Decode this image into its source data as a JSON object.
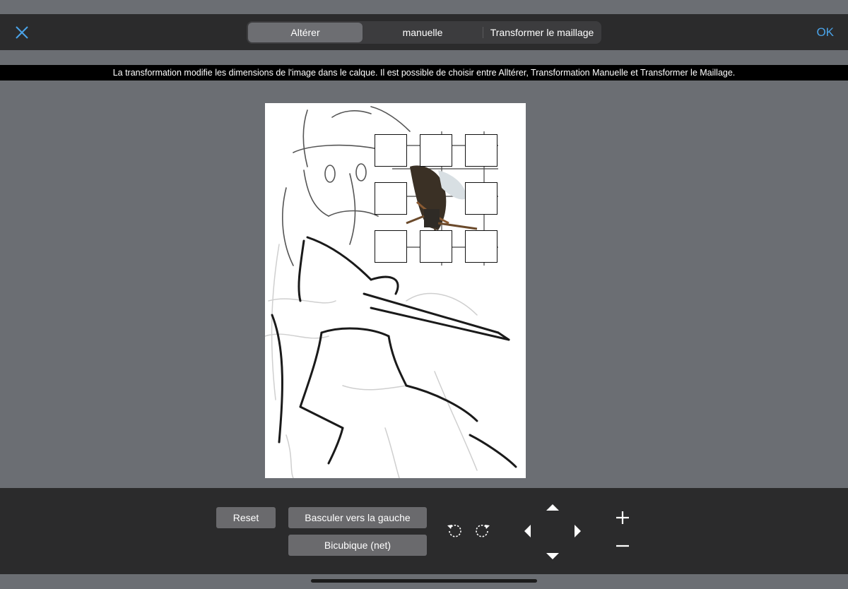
{
  "topbar": {
    "tabs": [
      {
        "label": "Altérer"
      },
      {
        "label": "manuelle"
      },
      {
        "label": "Transformer le maillage"
      }
    ],
    "ok_label": "OK"
  },
  "info_text": "La transformation modifie les dimensions de l'image dans le calque. Il est possible de choisir entre Alltérer, Transformation Manuelle et Transformer le Maillage.",
  "toolbar": {
    "reset_label": "Reset",
    "flip_label": "Basculer vers la gauche",
    "interp_label": "Bicubique (net)"
  },
  "colors": {
    "accent": "#4aa3e8",
    "bar": "#2b2b2c",
    "background": "#6b6e73",
    "button": "#6a6a6d"
  }
}
